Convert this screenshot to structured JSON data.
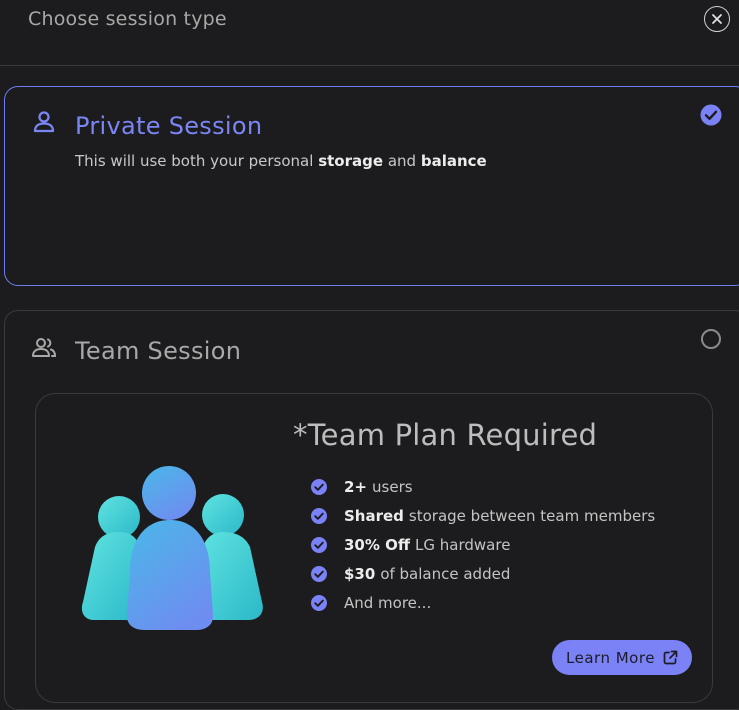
{
  "header": {
    "title": "Choose session type"
  },
  "icons": {
    "close": "close-icon",
    "person": "person-icon",
    "group": "group-icon",
    "check": "check-circle-icon",
    "external": "external-link-icon"
  },
  "colors": {
    "accent": "#7a82f6",
    "background": "#1c1c1e",
    "border": "#3a3a3c"
  },
  "options": {
    "private": {
      "title": "Private Session",
      "desc_prefix": "This will use both your personal",
      "desc_bold_1": "storage",
      "desc_mid": "and",
      "desc_bold_2": "balance",
      "selected": true
    },
    "team": {
      "title": "Team Session",
      "selected": false,
      "promo": {
        "title": "*Team Plan Required",
        "features": [
          {
            "bold": "2+",
            "text": "users"
          },
          {
            "bold": "Shared",
            "text": "storage between team members"
          },
          {
            "bold": "30% Off",
            "text": "LG hardware"
          },
          {
            "bold": "$30",
            "text": "of balance added"
          },
          {
            "bold": "",
            "text": "And more..."
          }
        ],
        "button_label": "Learn More"
      }
    }
  }
}
